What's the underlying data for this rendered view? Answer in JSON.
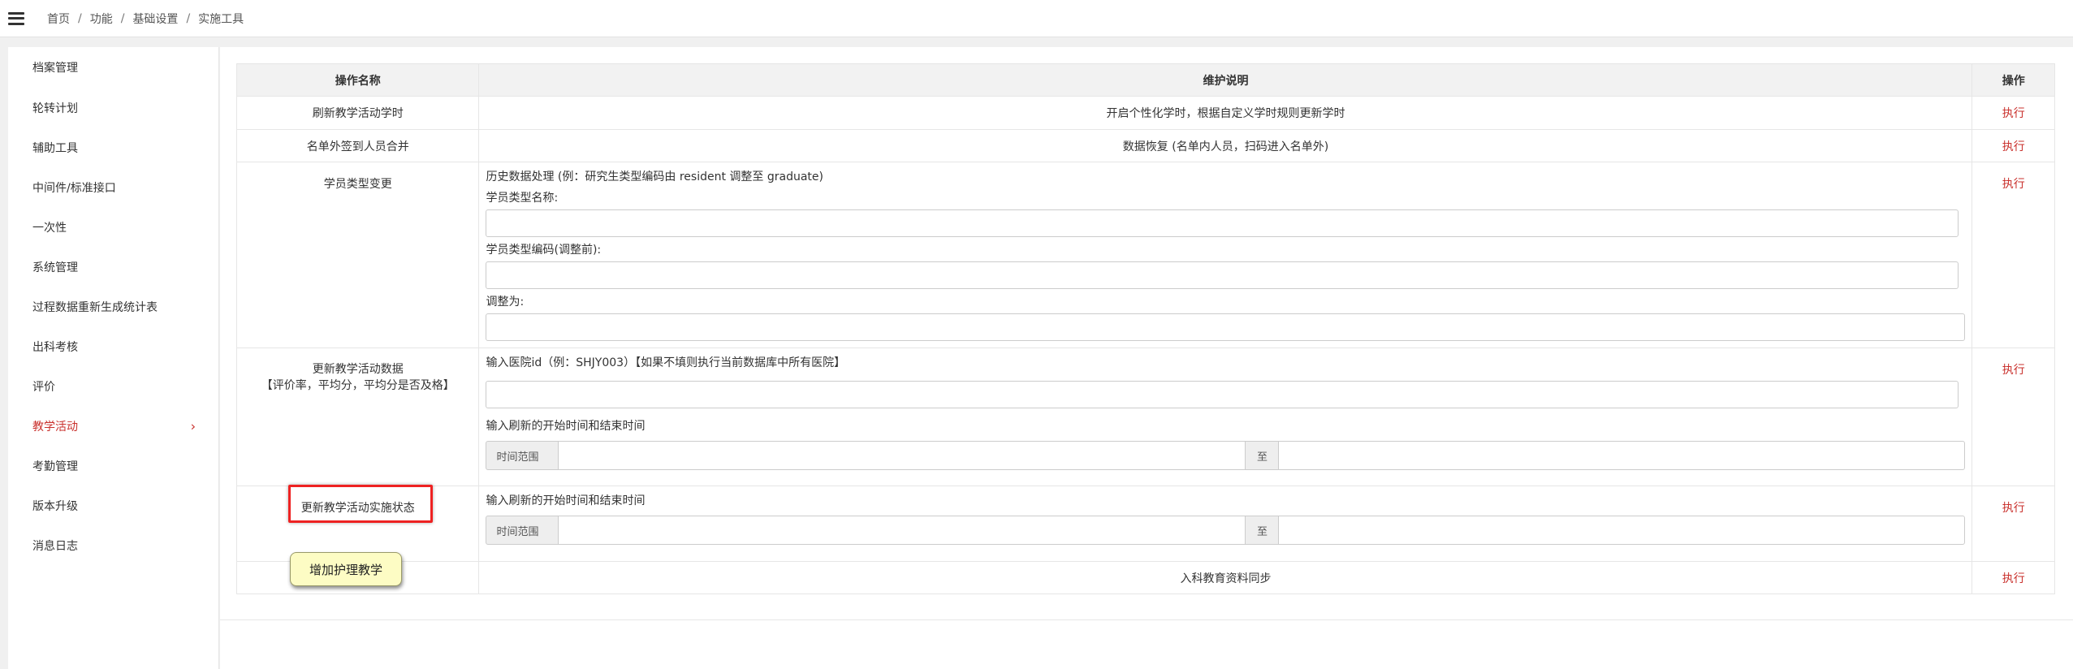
{
  "header": {
    "menu_icon": "hamburger-icon",
    "breadcrumb": [
      "首页",
      "功能",
      "基础设置",
      "实施工具"
    ],
    "separator": "/"
  },
  "sidebar": {
    "items": [
      {
        "label": "档案管理"
      },
      {
        "label": "轮转计划"
      },
      {
        "label": "辅助工具"
      },
      {
        "label": "中间件/标准接口"
      },
      {
        "label": "一次性"
      },
      {
        "label": "系统管理"
      },
      {
        "label": "过程数据重新生成统计表"
      },
      {
        "label": "出科考核"
      },
      {
        "label": "评价"
      },
      {
        "label": "教学活动",
        "active": true,
        "chevron": "›"
      },
      {
        "label": "考勤管理"
      },
      {
        "label": "版本升级"
      },
      {
        "label": "消息日志"
      }
    ],
    "active_color": "#c9302c"
  },
  "table": {
    "headers": {
      "name": "操作名称",
      "desc": "维护说明",
      "action": "操作"
    },
    "action_label": "执行",
    "rows": [
      {
        "name": "刷新教学活动学时",
        "desc": "开启个性化学时，根据自定义学时规则更新学时"
      },
      {
        "name": "名单外签到人员合并",
        "desc": "数据恢复 (名单内人员，扫码进入名单外)"
      },
      {
        "name": "学员类型变更",
        "desc": "历史数据处理 (例：研究生类型编码由 resident 调整至 graduate)",
        "fields": [
          "学员类型名称:",
          "学员类型编码(调整前):",
          "调整为:"
        ]
      },
      {
        "name_line1": "更新教学活动数据",
        "name_line2": "【评价率，平均分，平均分是否及格】",
        "desc": "输入医院id（例：SHJY003）【如果不填则执行当前数据库中所有医院】",
        "sub_label": "输入刷新的开始时间和结束时间",
        "range_label": "时间范围",
        "range_to": "至"
      },
      {
        "name": "更新教学活动实施状态",
        "sub_label": "输入刷新的开始时间和结束时间",
        "range_label": "时间范围",
        "range_to": "至"
      },
      {
        "name": "",
        "desc": "入科教育资料同步"
      }
    ]
  },
  "tooltip": {
    "text": "增加护理教学"
  },
  "colors": {
    "accent_red": "#c9302c",
    "highlight_red": "#ee2222",
    "tooltip_bg": "#fdfcc4"
  }
}
